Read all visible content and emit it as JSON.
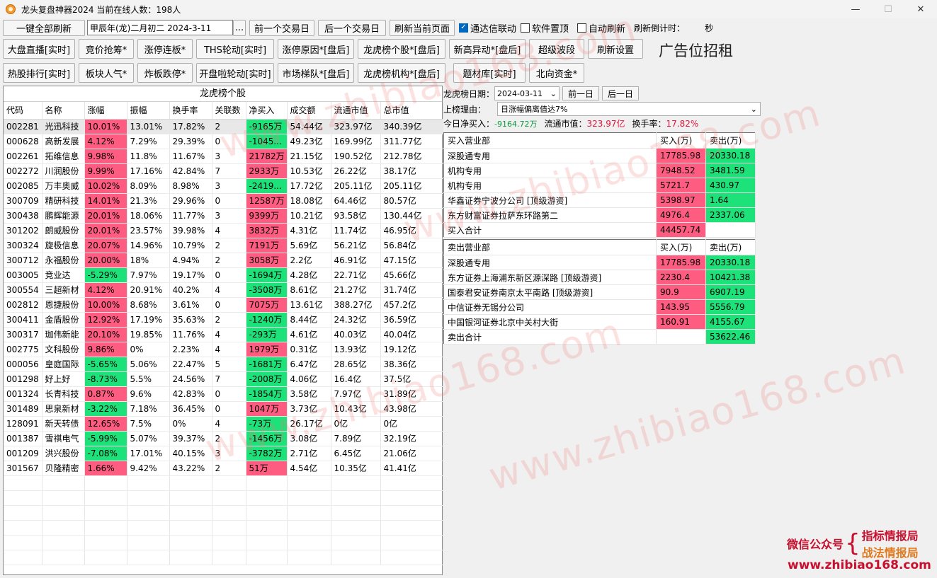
{
  "window": {
    "title": "龙头复盘神器2024 当前在线人数：198人",
    "min": "—",
    "max": "☐",
    "close": "✕"
  },
  "top": {
    "refresh_all": "一键全部刷新",
    "date_text": "甲辰年(龙)二月初二  2024-3-11",
    "dots": "...",
    "prev_day": "前一个交易日",
    "next_day": "后一个交易日",
    "refresh_page": "刷新当前页面",
    "chk_tdx": "通达信联动",
    "chk_top": "软件置顶",
    "chk_auto": "自动刷新",
    "countdown_label": "刷新倒计时：",
    "countdown_unit": "秒"
  },
  "toolbar1": [
    "大盘直播[实时]",
    "竞价抢筹*",
    "涨停连板*",
    "THS轮动[实时]",
    "涨停原因*[盘后]",
    "龙虎榜个股*[盘后]",
    "新高异动*[盘后]",
    "超级波段",
    "刷新设置"
  ],
  "toolbar2": [
    "热股排行[实时]",
    "板块人气*",
    "炸板跌停*",
    "开盘啦轮动[实时]",
    "市场梯队*[盘后]",
    "龙虎榜机构*[盘后]",
    "题材库[实时]",
    "北向资金*"
  ],
  "ad": "广告位招租",
  "left_panel": {
    "title": "龙虎榜个股",
    "columns": [
      "代码",
      "名称",
      "涨幅",
      "振幅",
      "换手率",
      "关联数",
      "净买入",
      "成交额",
      "流通市值",
      "总市值"
    ],
    "rows": [
      [
        "002281",
        "光迅科技",
        "10.01%",
        "13.01%",
        "17.82%",
        "2",
        "-9165万",
        "54.44亿",
        "323.97亿",
        "340.39亿"
      ],
      [
        "000628",
        "高新发展",
        "4.12%",
        "7.29%",
        "29.39%",
        "0",
        "-1045...",
        "49.23亿",
        "169.99亿",
        "311.77亿"
      ],
      [
        "002261",
        "拓维信息",
        "9.98%",
        "11.8%",
        "11.67%",
        "3",
        "21782万",
        "21.15亿",
        "190.52亿",
        "212.78亿"
      ],
      [
        "002272",
        "川润股份",
        "9.99%",
        "17.16%",
        "42.84%",
        "7",
        "2933万",
        "10.53亿",
        "26.22亿",
        "38.17亿"
      ],
      [
        "002085",
        "万丰奥威",
        "10.02%",
        "8.09%",
        "8.98%",
        "3",
        "-2419...",
        "17.72亿",
        "205.11亿",
        "205.11亿"
      ],
      [
        "300709",
        "精研科技",
        "14.01%",
        "21.3%",
        "29.96%",
        "0",
        "12587万",
        "18.08亿",
        "64.46亿",
        "80.57亿"
      ],
      [
        "300438",
        "鹏辉能源",
        "20.01%",
        "18.06%",
        "11.77%",
        "3",
        "9399万",
        "10.21亿",
        "93.58亿",
        "130.44亿"
      ],
      [
        "301202",
        "朗威股份",
        "20.01%",
        "23.57%",
        "39.98%",
        "4",
        "3832万",
        "4.31亿",
        "11.74亿",
        "46.95亿"
      ],
      [
        "300324",
        "旋极信息",
        "20.07%",
        "14.96%",
        "10.79%",
        "2",
        "7191万",
        "5.69亿",
        "56.21亿",
        "56.84亿"
      ],
      [
        "300712",
        "永福股份",
        "20.00%",
        "18%",
        "4.94%",
        "2",
        "3058万",
        "2.2亿",
        "46.91亿",
        "47.15亿"
      ],
      [
        "003005",
        "竞业达",
        "-5.29%",
        "7.97%",
        "19.17%",
        "0",
        "-1694万",
        "4.28亿",
        "22.71亿",
        "45.66亿"
      ],
      [
        "300554",
        "三超新材",
        "4.12%",
        "20.91%",
        "40.2%",
        "4",
        "-3508万",
        "8.61亿",
        "21.27亿",
        "31.74亿"
      ],
      [
        "002812",
        "恩捷股份",
        "10.00%",
        "8.68%",
        "3.61%",
        "0",
        "7075万",
        "13.61亿",
        "388.27亿",
        "457.2亿"
      ],
      [
        "300411",
        "金盾股份",
        "12.92%",
        "17.19%",
        "35.63%",
        "2",
        "-1240万",
        "8.44亿",
        "24.32亿",
        "36.59亿"
      ],
      [
        "300317",
        "珈伟新能",
        "20.10%",
        "19.85%",
        "11.76%",
        "4",
        "-293万",
        "4.61亿",
        "40.03亿",
        "40.04亿"
      ],
      [
        "002775",
        "文科股份",
        "9.86%",
        "0%",
        "2.23%",
        "4",
        "1979万",
        "0.31亿",
        "13.93亿",
        "19.12亿"
      ],
      [
        "000056",
        "皇庭国际",
        "-5.65%",
        "5.06%",
        "22.47%",
        "5",
        "-1681万",
        "6.47亿",
        "28.65亿",
        "38.36亿"
      ],
      [
        "001298",
        "好上好",
        "-8.73%",
        "5.5%",
        "24.56%",
        "7",
        "-2008万",
        "4.06亿",
        "16.4亿",
        "37.5亿"
      ],
      [
        "001324",
        "长青科技",
        "0.87%",
        "9.6%",
        "42.83%",
        "0",
        "-1854万",
        "3.58亿",
        "7.97亿",
        "31.89亿"
      ],
      [
        "301489",
        "思泉新材",
        "-3.22%",
        "7.18%",
        "36.45%",
        "0",
        "1047万",
        "3.73亿",
        "10.43亿",
        "43.98亿"
      ],
      [
        "128091",
        "新天转债",
        "12.65%",
        "7.5%",
        "0%",
        "4",
        "-73万",
        "26.17亿",
        "0亿",
        "0亿"
      ],
      [
        "001387",
        "雪祺电气",
        "-5.99%",
        "5.07%",
        "39.37%",
        "2",
        "-1456万",
        "3.08亿",
        "7.89亿",
        "32.19亿"
      ],
      [
        "001209",
        "洪兴股份",
        "-7.08%",
        "17.01%",
        "40.15%",
        "3",
        "-3782万",
        "2.71亿",
        "6.45亿",
        "21.06亿"
      ],
      [
        "301567",
        "贝隆精密",
        "1.66%",
        "9.42%",
        "43.22%",
        "2",
        "51万",
        "4.54亿",
        "10.35亿",
        "41.41亿"
      ]
    ]
  },
  "right_panel": {
    "date_label": "龙虎榜日期：",
    "date_value": "2024-03-11",
    "prev": "前一日",
    "next": "后一日",
    "reason_label": "上榜理由：",
    "reason_value": "日涨幅偏离值达7%",
    "net_buy_label": "今日净买入：",
    "net_buy_value": "-9164.72万",
    "float_label": "流通市值：",
    "float_value": "323.97亿",
    "turnover_label": "换手率：",
    "turnover_value": "17.82%",
    "buy": {
      "headers": [
        "买入营业部",
        "买入(万)",
        "卖出(万)"
      ],
      "rows": [
        [
          "深股通专用",
          "17785.98",
          "20330.18"
        ],
        [
          "机构专用",
          "7948.52",
          "3481.59"
        ],
        [
          "机构专用",
          "5721.7",
          "430.97"
        ],
        [
          "华鑫证券宁波分公司 [顶级游资]",
          "5398.97",
          "1.64"
        ],
        [
          "东方财富证券拉萨东环路第二",
          "4976.4",
          "2337.06"
        ]
      ],
      "total_label": "买入合计",
      "total_value": "44457.74"
    },
    "sell": {
      "headers": [
        "卖出营业部",
        "买入(万)",
        "卖出(万)"
      ],
      "rows": [
        [
          "深股通专用",
          "17785.98",
          "20330.18"
        ],
        [
          "东方证券上海浦东新区源深路 [顶级游资]",
          "2230.4",
          "10421.38"
        ],
        [
          "国泰君安证券南京太平南路 [顶级游资]",
          "90.9",
          "6907.19"
        ],
        [
          "中信证券无锡分公司",
          "143.95",
          "5556.79"
        ],
        [
          "中国银河证券北京中关村大街",
          "160.91",
          "4155.67"
        ]
      ],
      "total_label": "卖出合计",
      "total_value": "53622.46"
    }
  },
  "watermark": "www.zhibiao168.com",
  "branding": {
    "wechat_label": "微信公众号",
    "line1": "指标情报局",
    "line2": "战法情报局",
    "site": "www.zhibiao168.com"
  },
  "colors": {
    "up": "#ff5c82",
    "down": "#1de27a",
    "accent": "#0067c0"
  }
}
